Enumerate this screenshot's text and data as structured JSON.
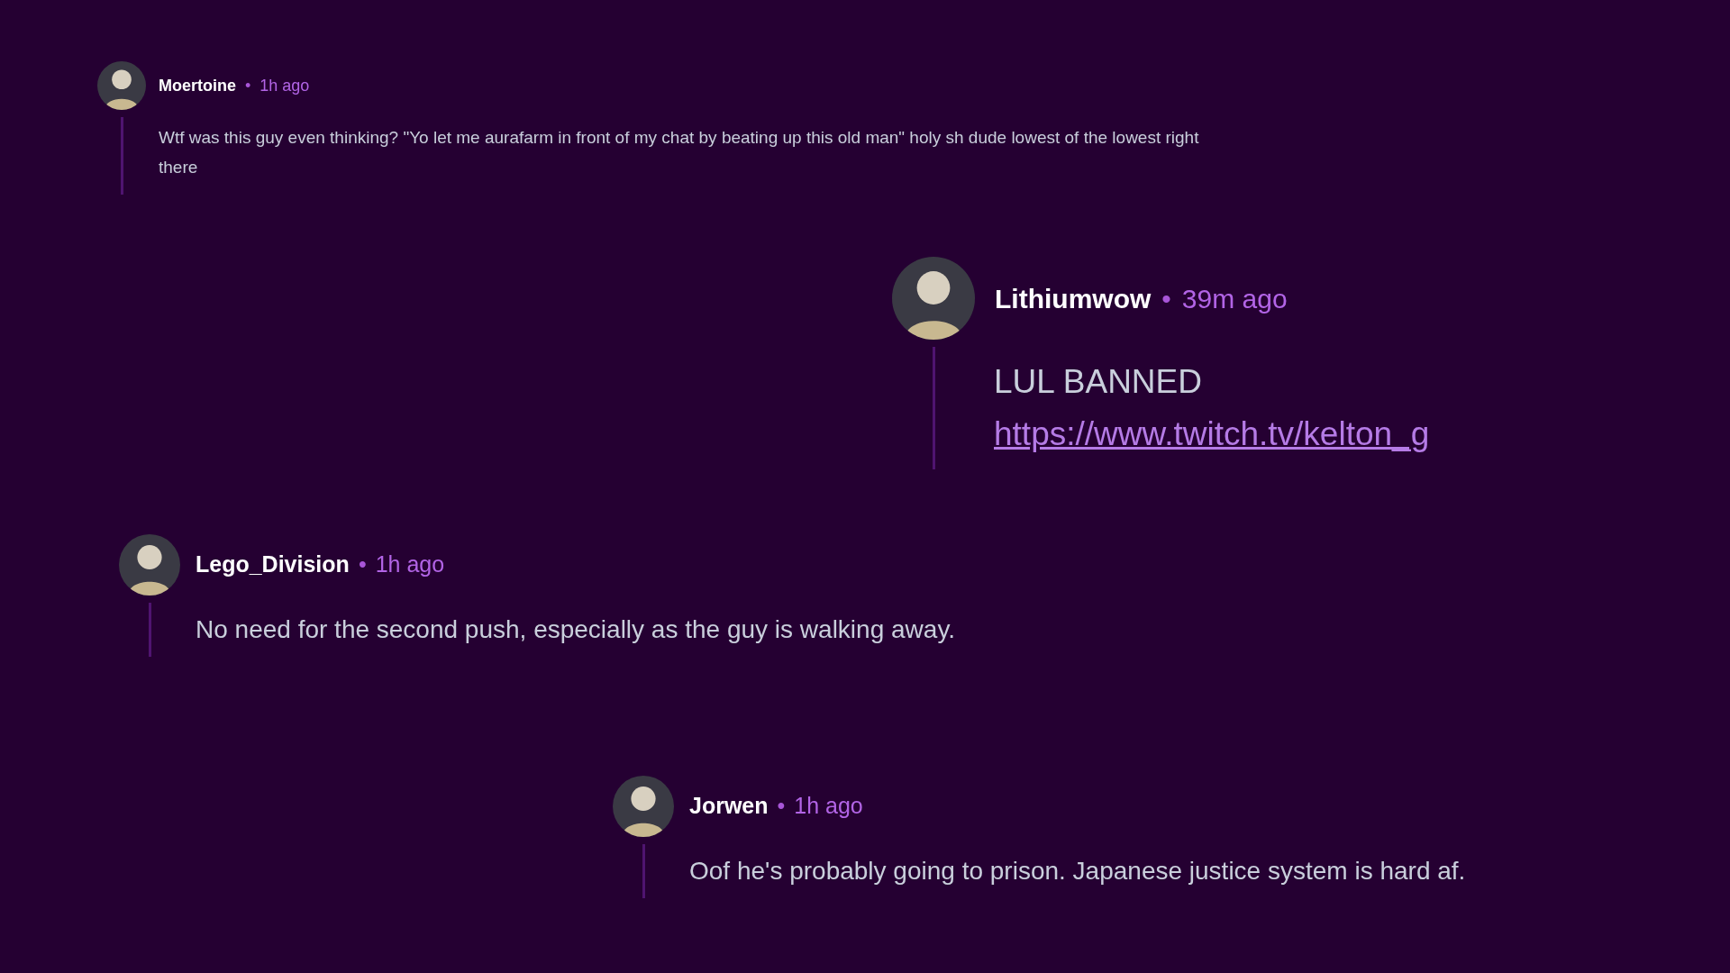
{
  "comments": [
    {
      "author": "Moertoine",
      "separator": "•",
      "time": "1h ago",
      "body": [
        {
          "kind": "text",
          "text": "Wtf was this guy even thinking? \"Yo let me aurafarm in front of my chat by beating up this old man\" holy sh dude lowest of the lowest right there"
        }
      ]
    },
    {
      "author": "Lithiumwow",
      "separator": "•",
      "time": "39m ago",
      "body": [
        {
          "kind": "text",
          "text": "LUL BANNED"
        },
        {
          "kind": "link",
          "text": "https://www.twitch.tv/kelton_g"
        }
      ]
    },
    {
      "author": "Lego_Division",
      "separator": "•",
      "time": "1h ago",
      "body": [
        {
          "kind": "text",
          "text": "No need for the second push, especially as the guy is walking away."
        }
      ]
    },
    {
      "author": "Jorwen",
      "separator": "•",
      "time": "1h ago",
      "body": [
        {
          "kind": "text",
          "text": "Oof he's probably going to prison. Japanese justice system is hard af."
        }
      ]
    }
  ]
}
